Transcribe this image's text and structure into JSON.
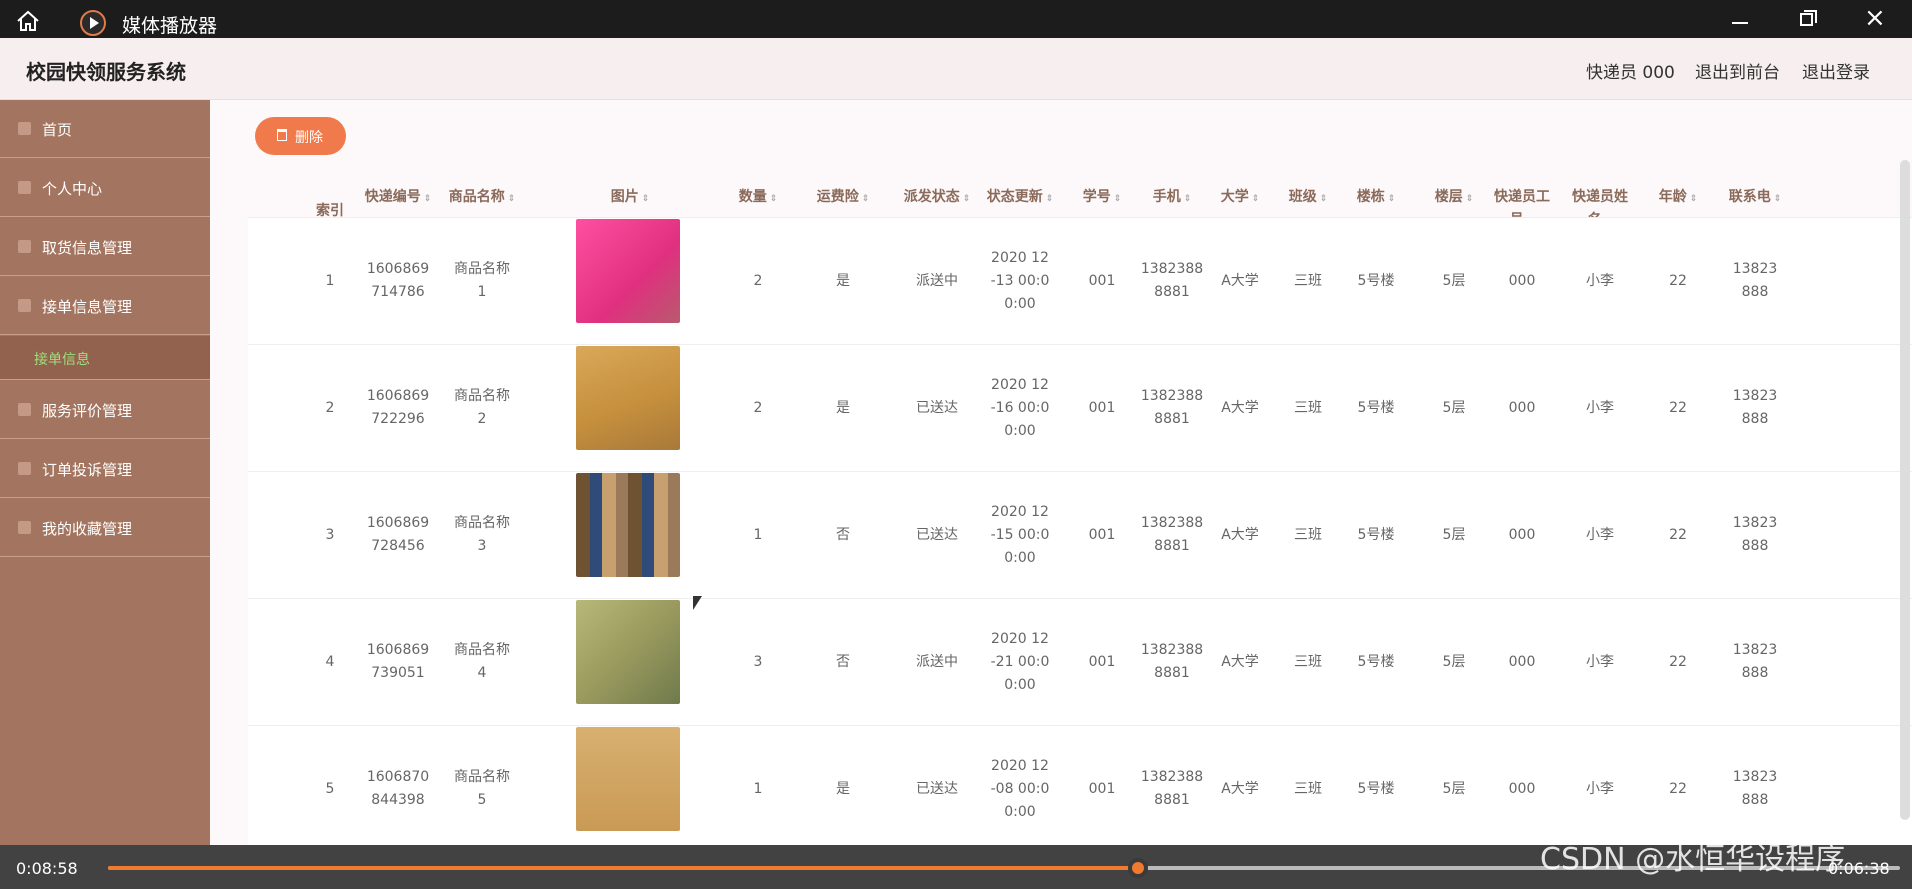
{
  "player": {
    "title": "媒体播放器",
    "elapsed": "0:08:58",
    "remaining": "0:06:38",
    "progress_fraction": 0.575,
    "watermark": "CSDN @水恒华设程序"
  },
  "header": {
    "system_title": "校园快领服务系统",
    "courier": "快递员 000",
    "back_to_front": "退出到前台",
    "logout": "退出登录"
  },
  "sidebar": {
    "items": [
      {
        "label": "首页"
      },
      {
        "label": "个人中心"
      },
      {
        "label": "取货信息管理"
      },
      {
        "label": "接单信息管理"
      },
      {
        "label": "服务评价管理"
      },
      {
        "label": "订单投诉管理"
      },
      {
        "label": "我的收藏管理"
      }
    ],
    "submenu": {
      "label": "接单信息"
    }
  },
  "toolbar": {
    "delete_label": "删除"
  },
  "table": {
    "headers": [
      {
        "l1": "索引",
        "l2": ""
      },
      {
        "l1": "快递编号",
        "l2": ""
      },
      {
        "l1": "商品名称",
        "l2": ""
      },
      {
        "l1": "图片",
        "l2": ""
      },
      {
        "l1": "数量",
        "l2": ""
      },
      {
        "l1": "运费险",
        "l2": ""
      },
      {
        "l1": "派发状态",
        "l2": ""
      },
      {
        "l1": "状态更新",
        "l2": ""
      },
      {
        "l1": "学号",
        "l2": ""
      },
      {
        "l1": "手机",
        "l2": ""
      },
      {
        "l1": "大学",
        "l2": ""
      },
      {
        "l1": "班级",
        "l2": ""
      },
      {
        "l1": "楼栋",
        "l2": ""
      },
      {
        "l1": "楼层",
        "l2": ""
      },
      {
        "l1": "快递员工",
        "l2": "号"
      },
      {
        "l1": "快递员姓",
        "l2": "名"
      },
      {
        "l1": "年龄",
        "l2": ""
      },
      {
        "l1": "联系电",
        "l2": ""
      }
    ],
    "rows": [
      {
        "index": "1",
        "code_a": "1606869",
        "code_b": "714786",
        "name_a": "商品名称",
        "name_b": "1",
        "qty": "2",
        "insurance": "是",
        "status": "派送中",
        "upd_a": "2020 12",
        "upd_b": "-13 00:0",
        "upd_c": "0:00",
        "student_no": "001",
        "phone_a": "1382388",
        "phone_b": "8881",
        "university": "A大学",
        "class": "三班",
        "building": "5号楼",
        "floor": "5层",
        "courier_no": "000",
        "courier_name": "小李",
        "age": "22",
        "contact_a": "13823",
        "contact_b": "888",
        "image": "pink-box"
      },
      {
        "index": "2",
        "code_a": "1606869",
        "code_b": "722296",
        "name_a": "商品名称",
        "name_b": "2",
        "qty": "2",
        "insurance": "是",
        "status": "已送达",
        "upd_a": "2020 12",
        "upd_b": "-16 00:0",
        "upd_c": "0:00",
        "student_no": "001",
        "phone_a": "1382388",
        "phone_b": "8881",
        "university": "A大学",
        "class": "三班",
        "building": "5号楼",
        "floor": "5层",
        "courier_no": "000",
        "courier_name": "小李",
        "age": "22",
        "contact_a": "13823",
        "contact_b": "888",
        "image": "cardboard-box"
      },
      {
        "index": "3",
        "code_a": "1606869",
        "code_b": "728456",
        "name_a": "商品名称",
        "name_b": "3",
        "qty": "1",
        "insurance": "否",
        "status": "已送达",
        "upd_a": "2020 12",
        "upd_b": "-15 00:0",
        "upd_c": "0:00",
        "student_no": "001",
        "phone_a": "1382388",
        "phone_b": "8881",
        "university": "A大学",
        "class": "三班",
        "building": "5号楼",
        "floor": "5层",
        "courier_no": "000",
        "courier_name": "小李",
        "age": "22",
        "contact_a": "13823",
        "contact_b": "888",
        "image": "parcel-pile"
      },
      {
        "index": "4",
        "code_a": "1606869",
        "code_b": "739051",
        "name_a": "商品名称",
        "name_b": "4",
        "qty": "3",
        "insurance": "否",
        "status": "派送中",
        "upd_a": "2020 12",
        "upd_b": "-21 00:0",
        "upd_c": "0:00",
        "student_no": "001",
        "phone_a": "1382388",
        "phone_b": "8881",
        "university": "A大学",
        "class": "三班",
        "building": "5号楼",
        "floor": "5层",
        "courier_no": "000",
        "courier_name": "小李",
        "age": "22",
        "contact_a": "13823",
        "contact_b": "888",
        "image": "green-box"
      },
      {
        "index": "5",
        "code_a": "1606870",
        "code_b": "844398",
        "name_a": "商品名称",
        "name_b": "5",
        "qty": "1",
        "insurance": "是",
        "status": "已送达",
        "upd_a": "2020 12",
        "upd_b": "-08 00:0",
        "upd_c": "0:00",
        "student_no": "001",
        "phone_a": "1382388",
        "phone_b": "8881",
        "university": "A大学",
        "class": "三班",
        "building": "5号楼",
        "floor": "5层",
        "courier_no": "000",
        "courier_name": "小李",
        "age": "22",
        "contact_a": "13823",
        "contact_b": "888",
        "image": "labeled-box"
      }
    ]
  },
  "colors": {
    "accent": "#f07a4c",
    "sidebar": "#a37560",
    "progress": "#f07a30"
  }
}
